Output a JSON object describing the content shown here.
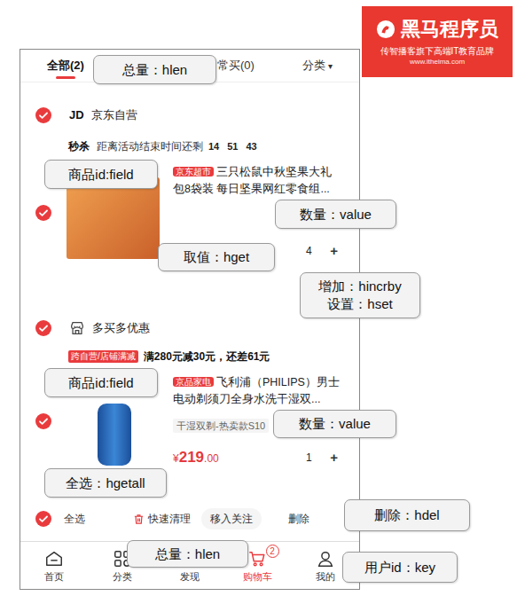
{
  "logo": {
    "name": "黑马程序员",
    "slogan": "传智播客旗下高端IT教育品牌",
    "url": "www.itheima.com"
  },
  "tabs": [
    {
      "label": "全部(2)",
      "selected": true
    },
    {
      "label": "常买(0)",
      "selected": false
    }
  ],
  "filter": {
    "label": "分类",
    "caret": "▾"
  },
  "shops": [
    {
      "kind": "flash",
      "checked": true,
      "badge": "JD",
      "name": "京东自营",
      "flash": {
        "label": "秒杀",
        "text": "距离活动结束时间还剩",
        "timer": [
          "14",
          "51",
          "43"
        ]
      },
      "items": [
        {
          "checked": true,
          "tag": "京东超市",
          "title_lines": [
            "三只松鼠中秋坚果大礼",
            "包8袋装 每日坚果网红零食组..."
          ],
          "quantity": "4",
          "plus": "+"
        }
      ]
    },
    {
      "kind": "promo",
      "checked": true,
      "name": "多买多优惠",
      "promo": {
        "tag": "跨自营/店铺满减",
        "text": "满280元减30元，还差61元"
      },
      "items": [
        {
          "checked": true,
          "tag": "京品家电",
          "title_lines": [
            "飞利浦（PHILIPS）男士",
            "电动剃须刀全身水洗干湿双..."
          ],
          "spec": "干湿双剃-热卖款S10",
          "price": {
            "currency": "¥",
            "integer": "219",
            "decimal": ".00"
          },
          "quantity": "1",
          "plus": "+"
        }
      ]
    }
  ],
  "footer": {
    "select_all": {
      "label": "全选",
      "checked": true
    },
    "clean": "快速清理",
    "follow": "移入关注",
    "delete": "删除"
  },
  "nav": [
    {
      "label": "首页",
      "selected": false
    },
    {
      "label": "分类",
      "selected": false
    },
    {
      "label": "发现",
      "selected": false
    },
    {
      "label": "购物车",
      "selected": true,
      "badge": "2"
    },
    {
      "label": "我的",
      "selected": false
    }
  ],
  "callouts": [
    {
      "lines": [
        "总量：hlen"
      ]
    },
    {
      "lines": [
        "商品id:field"
      ]
    },
    {
      "lines": [
        "数量：value"
      ]
    },
    {
      "lines": [
        "取值：hget"
      ]
    },
    {
      "lines": [
        "增加：hincrby",
        "设置：hset"
      ]
    },
    {
      "lines": [
        "商品id:field"
      ]
    },
    {
      "lines": [
        "数量：value"
      ]
    },
    {
      "lines": [
        "全选：hgetall"
      ]
    },
    {
      "lines": [
        "删除：hdel"
      ]
    },
    {
      "lines": [
        "总量：hlen"
      ]
    },
    {
      "lines": [
        "用户id：key"
      ]
    }
  ]
}
